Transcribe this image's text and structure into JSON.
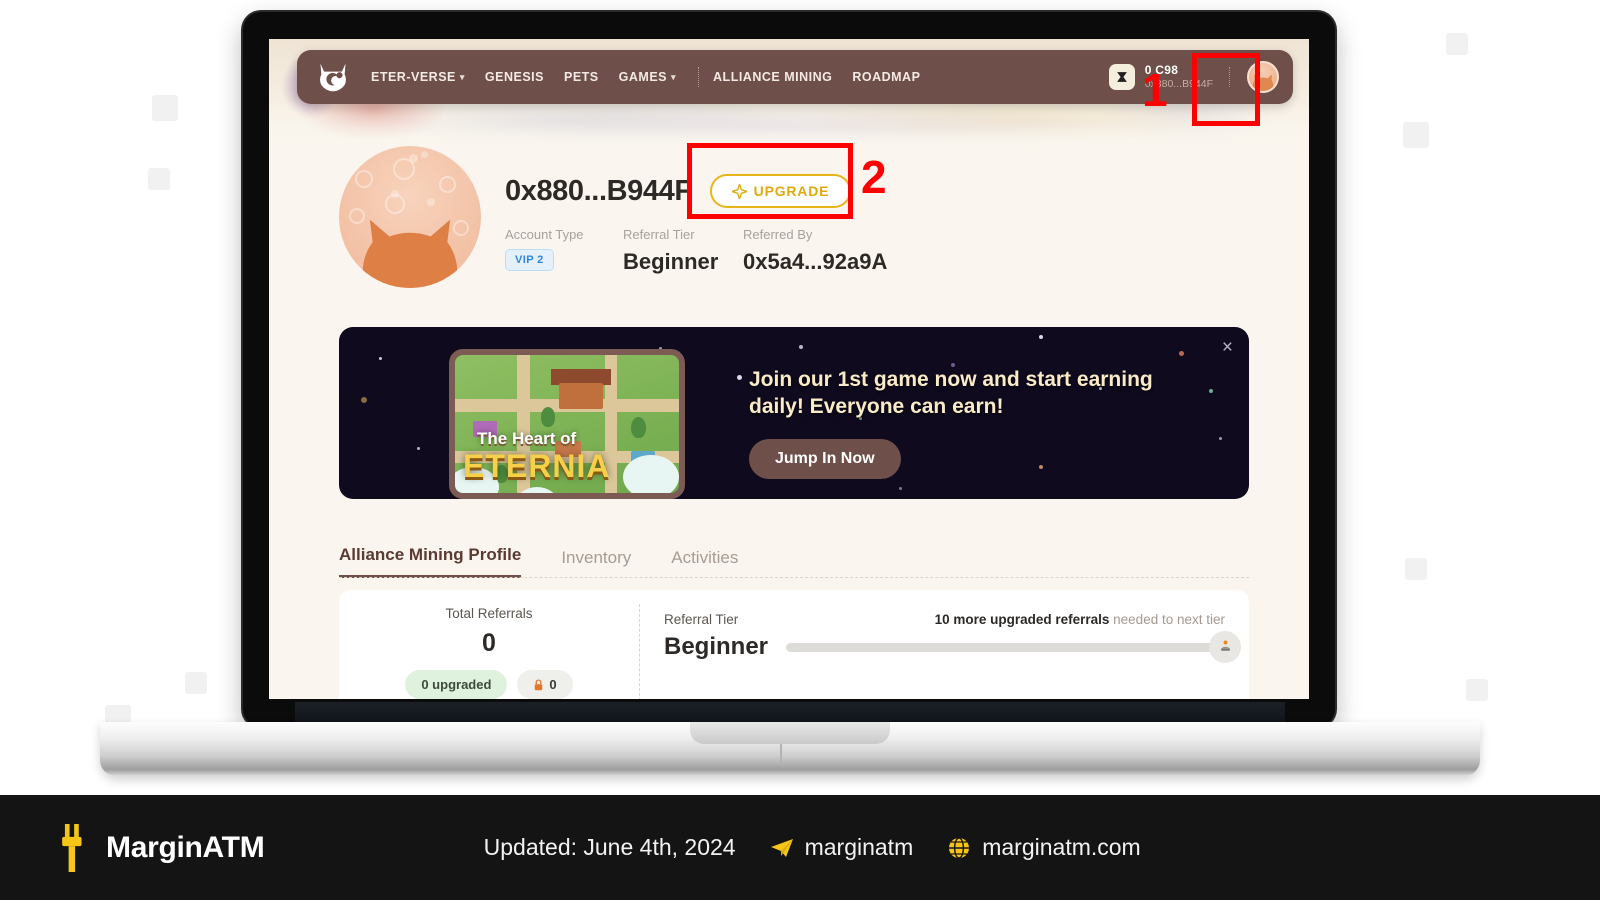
{
  "navbar": {
    "logo_icon": "eternal-monster-logo-icon",
    "links": [
      {
        "label": "ETER-VERSE",
        "has_caret": true
      },
      {
        "label": "GENESIS",
        "has_caret": false
      },
      {
        "label": "PETS",
        "has_caret": false
      },
      {
        "label": "GAMES",
        "has_caret": true
      }
    ],
    "links_right": [
      {
        "label": "ALLIANCE MINING"
      },
      {
        "label": "ROADMAP"
      }
    ],
    "wallet": {
      "token_icon": "token-icon",
      "balance": "0 C98",
      "address": "0x880...B944F"
    },
    "avatar_icon": "cat-avatar-icon"
  },
  "profile": {
    "avatar_icon": "cat-avatar-large-icon",
    "wallet_address": "0x880...B944F",
    "upgrade_label": "UPGRADE",
    "upgrade_icon": "sparkle-icon",
    "fields": [
      {
        "label": "Account Type",
        "value": "VIP 2",
        "type": "badge"
      },
      {
        "label": "Referral Tier",
        "value": "Beginner",
        "type": "text"
      },
      {
        "label": "Referred By",
        "value": "0x5a4...92a9A",
        "type": "text"
      }
    ]
  },
  "promo": {
    "close_icon": "close-icon",
    "game_title_small": "The Heart of",
    "game_title_big": "ETERNIA",
    "headline": "Join our 1st game now and start earning daily! Everyone can earn!",
    "cta_label": "Jump In Now"
  },
  "tabs": [
    {
      "label": "Alliance Mining Profile",
      "active": true
    },
    {
      "label": "Inventory",
      "active": false
    },
    {
      "label": "Activities",
      "active": false
    }
  ],
  "stats": {
    "total_referrals_label": "Total Referrals",
    "total_referrals_value": "0",
    "upgraded_pill": "0 upgraded",
    "locked_pill": "0",
    "lock_icon": "lock-icon",
    "referral_tier_label": "Referral Tier",
    "referral_tier_value": "Beginner",
    "next_tier_bold": "10 more upgraded referrals",
    "next_tier_rest": " needed to next tier",
    "progress_percent": 0,
    "progress_end_icon": "tier-trophy-icon"
  },
  "annotations": [
    {
      "number": "1",
      "target": "navbar-avatar"
    },
    {
      "number": "2",
      "target": "upgrade-button"
    }
  ],
  "footer": {
    "brand_icon": "marginatm-logo-icon",
    "brand_name": "MarginATM",
    "updated": "Updated: June 4th, 2024",
    "telegram_icon": "telegram-icon",
    "telegram_handle": "marginatm",
    "globe_icon": "globe-icon",
    "website": "marginatm.com"
  },
  "colors": {
    "nav_brown": "#6E4F49",
    "page_cream": "#FAF6EF",
    "gold": "#E0A90F",
    "promo_dark": "#0F0A1E",
    "annotation_red": "#FF0000",
    "footer_black": "#141414",
    "brand_yellow": "#F5C518"
  }
}
